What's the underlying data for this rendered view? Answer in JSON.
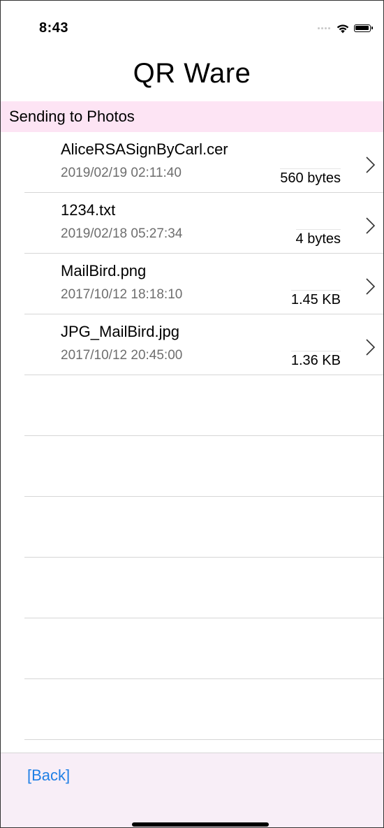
{
  "status_bar": {
    "time": "8:43"
  },
  "header": {
    "title": "QR Ware"
  },
  "section": {
    "label": "Sending to Photos"
  },
  "files": [
    {
      "name": "AliceRSASignByCarl.cer",
      "date": "2019/02/19  02:11:40",
      "size": "560 bytes"
    },
    {
      "name": "1234.txt",
      "date": "2019/02/18  05:27:34",
      "size": "4 bytes"
    },
    {
      "name": "MailBird.png",
      "date": "2017/10/12  18:18:10",
      "size": "1.45 KB"
    },
    {
      "name": "JPG_MailBird.jpg",
      "date": "2017/10/12  20:45:00",
      "size": "1.36 KB"
    }
  ],
  "toolbar": {
    "back_label": "[Back]"
  },
  "icons": {
    "wifi": "wifi-icon",
    "battery": "battery-icon",
    "cell_signal": "cell-signal-icon",
    "chevron": "chevron-right-icon"
  },
  "colors": {
    "section_background": "#fde4f4",
    "toolbar_background": "#f8eef7",
    "link": "#1f7fe5"
  }
}
